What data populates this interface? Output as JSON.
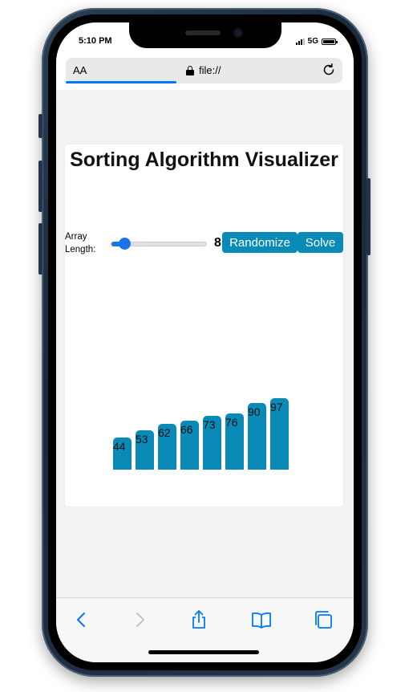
{
  "status_bar": {
    "time": "5:10 PM",
    "network": "5G"
  },
  "url_bar": {
    "text_size_label": "AA",
    "address": "file://",
    "load_progress": 0.4
  },
  "app": {
    "title": "Sorting Algorithm Visualizer",
    "array_length_label": "Array Length:",
    "array_length": 8,
    "array_length_value": "8",
    "slider": {
      "value": 8,
      "min": 5,
      "max": 100
    },
    "randomize_label": "Randomize",
    "solve_label": "Solve"
  },
  "chart_data": {
    "type": "bar",
    "values": [
      44,
      53,
      62,
      66,
      73,
      76,
      90,
      97
    ],
    "labels": [
      "44",
      "53",
      "62",
      "66",
      "73",
      "76",
      "90",
      "97"
    ]
  },
  "colors": {
    "accent": "#0a8ab6",
    "slider": "#1a73e8",
    "safari_blue": "#007aff"
  },
  "toolbar": {
    "icons": [
      "back-icon",
      "forward-icon",
      "share-icon",
      "bookmarks-icon",
      "tabs-icon"
    ]
  }
}
